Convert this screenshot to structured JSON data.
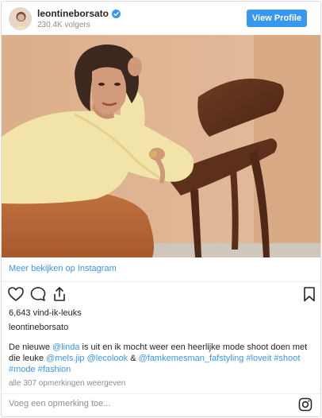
{
  "header": {
    "username": "leontineborsato",
    "followers": "230.4K volgers",
    "view_profile_label": "View Profile",
    "verified_icon": "verified-badge-icon",
    "avatar_icon": "profile-avatar"
  },
  "post": {
    "photo_description_icon": "post-photo",
    "more_link": "Meer bekijken op Instagram",
    "likes": "6,643 vind-ik-leuks",
    "owner": "leontineborsato",
    "caption": {
      "part1": "De nieuwe ",
      "tag1": "@linda",
      "part2": " is uit en ik mocht weer een heerlijke mode shoot doen met die leuke ",
      "tag2": "@mels.jip",
      "part3": " ",
      "tag3": "@lecolook",
      "part4": " & ",
      "tag4": "@famkemesman_fafstyling",
      "part5": " ",
      "tag5": "#loveit",
      "part6": " ",
      "tag6": "#shoot",
      "part7": " ",
      "tag7": "#mode",
      "part8": " ",
      "tag8": "#fashion"
    },
    "comments_count": "alle 307 opmerkingen weergeven",
    "comment_placeholder": "Voeg een opmerking toe...",
    "icons": [
      "heart-icon",
      "comment-icon",
      "share-icon",
      "bookmark-icon",
      "instagram-icon"
    ]
  },
  "colors": {
    "accent": "#3897f0",
    "text": "#262626",
    "muted": "#8e8e8e",
    "border": "#dbdbdb"
  }
}
